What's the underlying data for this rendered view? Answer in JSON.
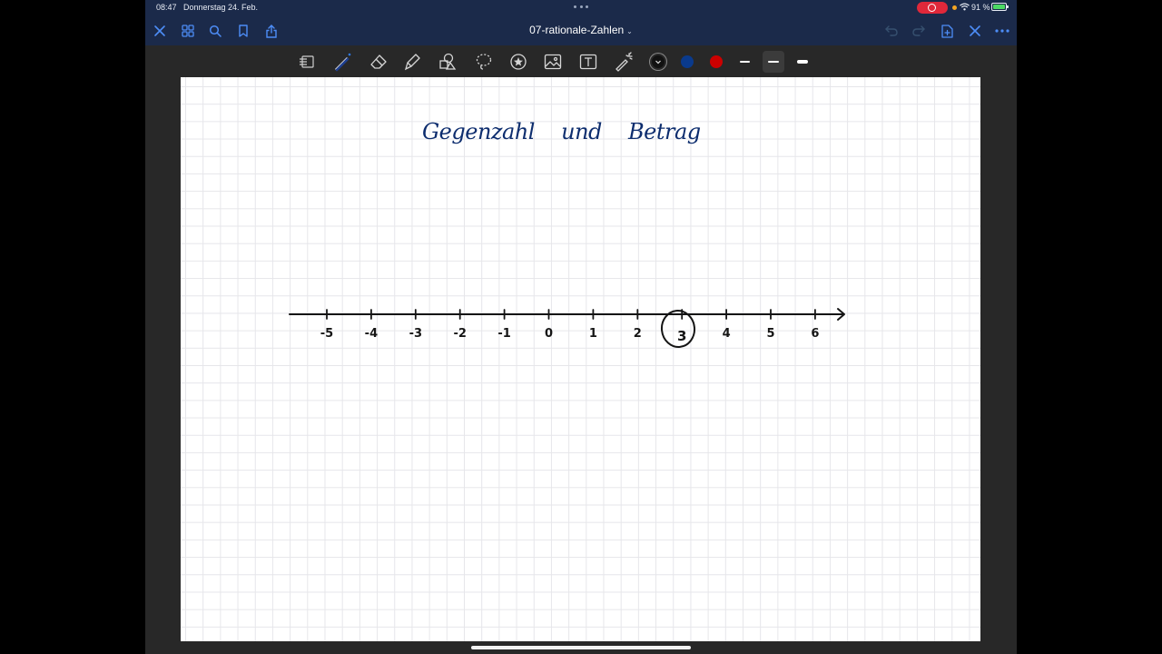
{
  "status": {
    "time": "08:47",
    "date": "Donnerstag 24. Feb.",
    "battery": "91 %",
    "battery_level": 0.91
  },
  "navbar": {
    "title": "07-rationale-Zahlen",
    "icons": [
      "close-icon",
      "thumbnails-icon",
      "search-icon",
      "bookmark-icon",
      "share-icon",
      "undo-icon",
      "redo-icon",
      "add-page-icon",
      "close-icon",
      "more-icon"
    ]
  },
  "toolbar": {
    "tools": [
      "page-tool-icon",
      "pen-icon",
      "eraser-icon",
      "highlighter-icon",
      "shapes-icon",
      "lasso-icon",
      "sticker-icon",
      "image-icon",
      "text-icon",
      "laser-pointer-icon"
    ],
    "colors": [
      "#111111",
      "#0a3a8c",
      "#cc0000"
    ],
    "stroke_widths": [
      "thin",
      "medium",
      "thick"
    ],
    "selected_stroke": "medium",
    "accent": "#2f7cf6"
  },
  "note": {
    "heading": "Gegenzahl und Betrag",
    "ink_color": "#0d2d6e",
    "number_line": {
      "tick_labels": [
        "-5",
        "-4",
        "-3",
        "-2",
        "-1",
        "0",
        "1",
        "2",
        "3",
        "4",
        "5",
        "6"
      ],
      "circled": "3"
    }
  }
}
